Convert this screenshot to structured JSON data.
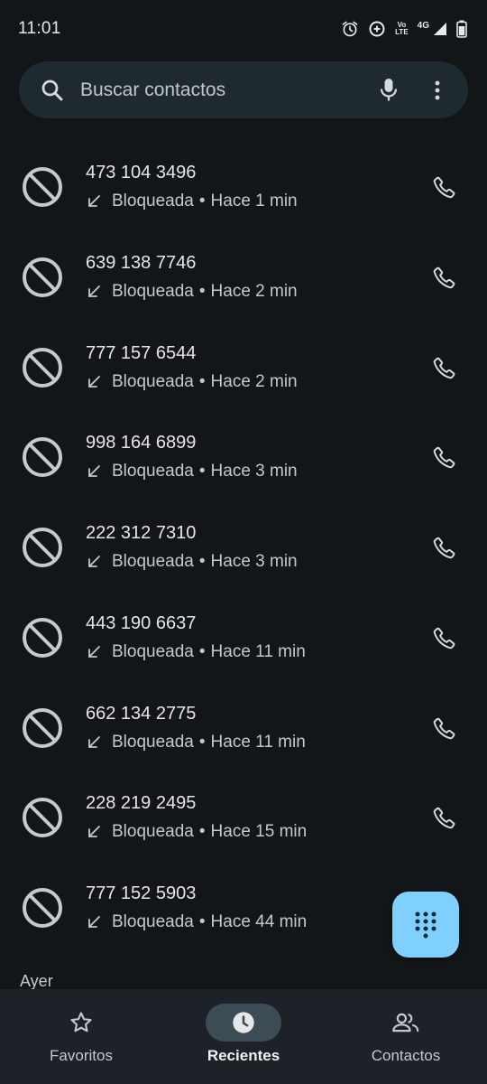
{
  "status_bar": {
    "time": "11:01",
    "volte_top": "Vo",
    "volte_bottom": "LTE",
    "network": "4G",
    "icons": [
      "alarm-icon",
      "data-saver-icon",
      "volte-icon",
      "signal-icon",
      "battery-icon"
    ]
  },
  "search": {
    "placeholder": "Buscar contactos",
    "icons": [
      "search-icon",
      "mic-icon",
      "more-vert-icon"
    ]
  },
  "calls": [
    {
      "number": "473 104 3496",
      "status": "Bloqueada",
      "separator": "•",
      "time": "Hace 1 min"
    },
    {
      "number": "639 138 7746",
      "status": "Bloqueada",
      "separator": "•",
      "time": "Hace 2 min"
    },
    {
      "number": "777 157 6544",
      "status": "Bloqueada",
      "separator": "•",
      "time": "Hace 2 min"
    },
    {
      "number": "998 164 6899",
      "status": "Bloqueada",
      "separator": "•",
      "time": "Hace 3 min"
    },
    {
      "number": "222 312 7310",
      "status": "Bloqueada",
      "separator": "•",
      "time": "Hace 3 min"
    },
    {
      "number": "443 190 6637",
      "status": "Bloqueada",
      "separator": "•",
      "time": "Hace 11 min"
    },
    {
      "number": "662 134 2775",
      "status": "Bloqueada",
      "separator": "•",
      "time": "Hace 11 min"
    },
    {
      "number": "228 219 2495",
      "status": "Bloqueada",
      "separator": "•",
      "time": "Hace 15 min"
    },
    {
      "number": "777 152 5903",
      "status": "Bloqueada",
      "separator": "•",
      "time": "Hace 44 min"
    }
  ],
  "section_header": "Ayer",
  "fab": {
    "icon": "dialpad-icon"
  },
  "bottom_nav": [
    {
      "label": "Favoritos",
      "icon": "star-icon",
      "active": false
    },
    {
      "label": "Recientes",
      "icon": "clock-icon",
      "active": true
    },
    {
      "label": "Contactos",
      "icon": "people-icon",
      "active": false
    }
  ],
  "colors": {
    "background": "#121619",
    "search_bg": "#1e2a30",
    "fab": "#7fd0ff",
    "nav_bg": "#1c2227",
    "nav_active_pill": "#3d4b55"
  }
}
